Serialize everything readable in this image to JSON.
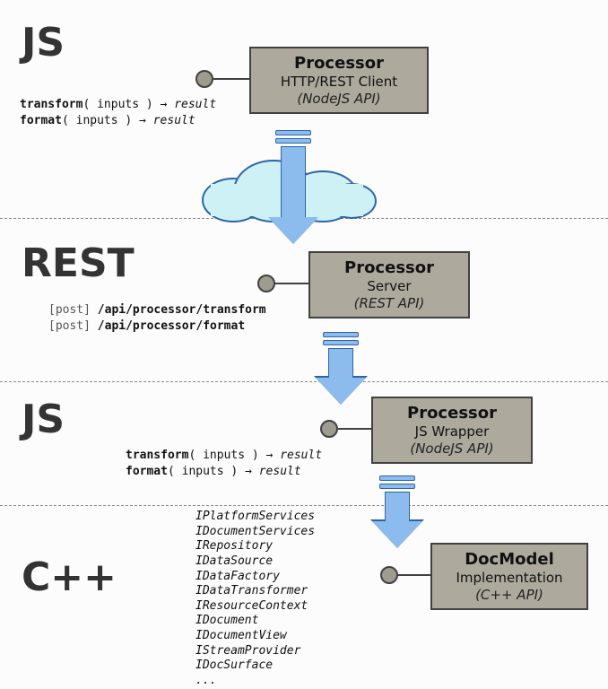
{
  "layers": {
    "js1": "JS",
    "rest": "REST",
    "js2": "JS",
    "cpp": "C++"
  },
  "boxes": {
    "proc1": {
      "title": "Processor",
      "sub": "HTTP/REST Client",
      "api": "(NodeJS API)"
    },
    "proc2": {
      "title": "Processor",
      "sub": "Server",
      "api": "(REST API)"
    },
    "proc3": {
      "title": "Processor",
      "sub": "JS Wrapper",
      "api": "(NodeJS API)"
    },
    "doc": {
      "title": "DocModel",
      "sub": "Implementation",
      "api": "(C++ API)"
    }
  },
  "code1": {
    "l1a": "transform",
    "l1b": "( inputs ) → ",
    "l1c": "result",
    "l2a": "format",
    "l2b": "( inputs ) → ",
    "l2c": "result"
  },
  "code2": {
    "l1a": "[post] ",
    "l1b": "/api/processor/transform",
    "l2a": "[post] ",
    "l2b": "/api/processor/format"
  },
  "code3": {
    "l1a": "transform",
    "l1b": "( inputs ) → ",
    "l1c": "result",
    "l2a": "format",
    "l2b": "( inputs ) → ",
    "l2c": "result"
  },
  "interfaces": [
    "IPlatformServices",
    "IDocumentServices",
    "IRepository",
    "IDataSource",
    "IDataFactory",
    "IDataTransformer",
    "IResourceContext",
    "IDocument",
    "IDocumentView",
    "IStreamProvider",
    "IDocSurface",
    "..."
  ]
}
